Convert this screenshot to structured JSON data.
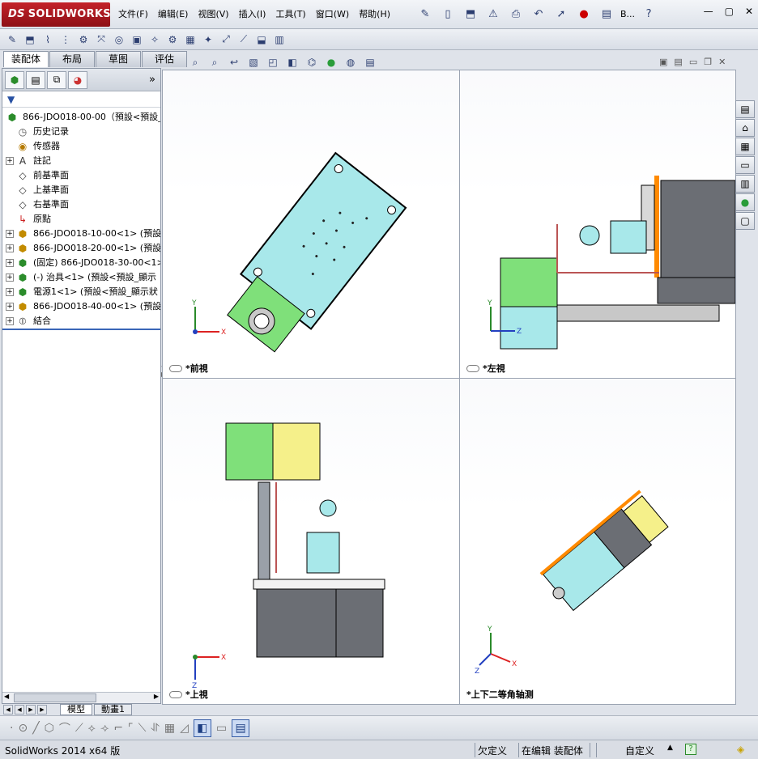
{
  "app": {
    "brand": "SOLIDWORKS",
    "brand_prefix": "DS"
  },
  "menu": [
    "文件(F)",
    "编辑(E)",
    "视图(V)",
    "插入(I)",
    "工具(T)",
    "窗口(W)",
    "帮助(H)"
  ],
  "qa_extra_label": "B...",
  "cm_tabs": [
    "装配体",
    "布局",
    "草图",
    "评估"
  ],
  "fm": {
    "expand_label": "»",
    "tree": [
      {
        "label": "866-JDO018-00-00（預設<預設_顯",
        "icon": "assembly-icon",
        "expand": false,
        "indent": 0
      },
      {
        "label": "历史记录",
        "icon": "history-icon",
        "expand": false,
        "indent": 1
      },
      {
        "label": "传感器",
        "icon": "sensor-icon",
        "expand": false,
        "indent": 1
      },
      {
        "label": "註記",
        "icon": "annotation-icon",
        "expand": true,
        "indent": 1
      },
      {
        "label": "前基準面",
        "icon": "plane-icon",
        "expand": false,
        "indent": 1
      },
      {
        "label": "上基準面",
        "icon": "plane-icon",
        "expand": false,
        "indent": 1
      },
      {
        "label": "右基準面",
        "icon": "plane-icon",
        "expand": false,
        "indent": 1
      },
      {
        "label": "原點",
        "icon": "origin-icon",
        "expand": false,
        "indent": 1
      },
      {
        "label": "866-JDO018-10-00<1> (預設<",
        "icon": "subassembly-icon",
        "expand": true,
        "indent": 1
      },
      {
        "label": "866-JDO018-20-00<1> (預設<",
        "icon": "subassembly-icon",
        "expand": true,
        "indent": 1
      },
      {
        "label": "(固定) 866-JDO018-30-00<1> (",
        "icon": "assembly-icon",
        "expand": true,
        "indent": 1
      },
      {
        "label": "(-) 治具<1> (預設<預設_顯示",
        "icon": "assembly-icon",
        "expand": true,
        "indent": 1
      },
      {
        "label": "電源1<1> (預設<預設_顯示狀",
        "icon": "assembly-icon",
        "expand": true,
        "indent": 1
      },
      {
        "label": "866-JDO018-40-00<1> (預設<",
        "icon": "subassembly-icon",
        "expand": true,
        "indent": 1
      },
      {
        "label": "結合",
        "icon": "mates-icon",
        "expand": true,
        "indent": 1
      }
    ]
  },
  "bottom_tabs": [
    "模型",
    "動畫1"
  ],
  "viewports": {
    "front": {
      "label": "*前視",
      "x": "X",
      "y": "Y"
    },
    "left": {
      "label": "*左視",
      "z": "Z",
      "y": "Y"
    },
    "top": {
      "label": "*上視",
      "x": "X",
      "z": "Z"
    },
    "iso": {
      "label": "*上下二等角轴测",
      "x": "X",
      "y": "Y",
      "z": "Z"
    }
  },
  "status": {
    "version": "SolidWorks 2014 x64 版",
    "define": "欠定义",
    "editing": "在编辑 装配体",
    "custom": "自定义"
  },
  "colors": {
    "cyan_part": "#a8e8ea",
    "green_part": "#7fe07a",
    "grey_part": "#6b6e74",
    "orange_part": "#ff8a00",
    "yellow_part": "#f5f08a"
  }
}
